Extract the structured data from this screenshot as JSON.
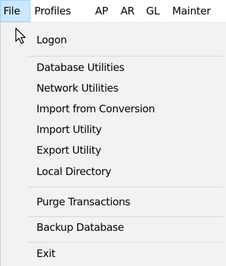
{
  "menubar": {
    "items": [
      {
        "label": "File",
        "active": true
      },
      {
        "label": "Profiles",
        "active": false
      },
      {
        "label": "AP",
        "active": false
      },
      {
        "label": "AR",
        "active": false
      },
      {
        "label": "GL",
        "active": false
      },
      {
        "label": "Mainter",
        "active": false
      }
    ]
  },
  "file_menu": {
    "items": [
      {
        "label": "Logon"
      },
      {
        "label": "Database Utilities"
      },
      {
        "label": "Network Utilities"
      },
      {
        "label": "Import from Conversion"
      },
      {
        "label": "Import Utility"
      },
      {
        "label": "Export Utility"
      },
      {
        "label": "Local Directory"
      },
      {
        "label": "Purge Transactions"
      },
      {
        "label": "Backup Database"
      },
      {
        "label": "Exit"
      }
    ]
  },
  "cursor": {
    "icon": "mouse-pointer-icon"
  },
  "colors": {
    "menu_background": "#f2f2f2",
    "active_highlight": "#cce8ff",
    "active_border": "#99d1ff",
    "separator": "#d7d7d7"
  }
}
